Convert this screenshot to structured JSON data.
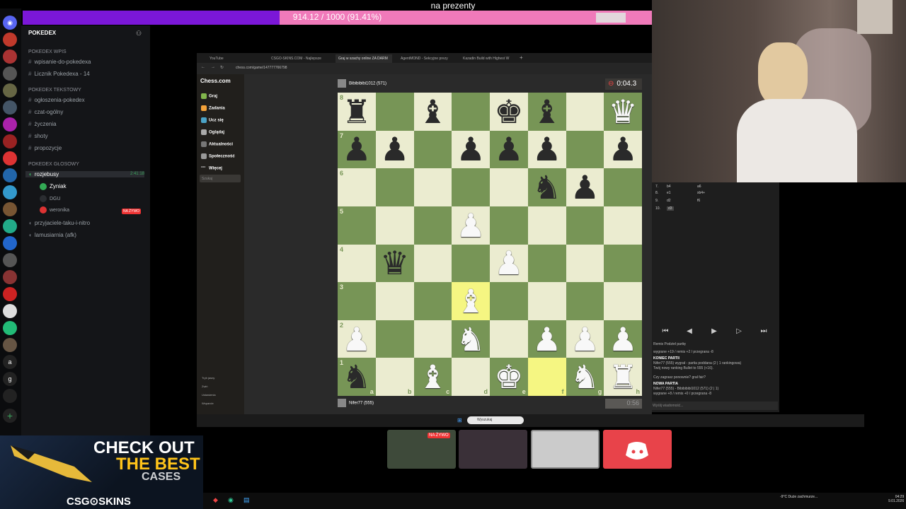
{
  "stream": {
    "goal_title": "na prezenty",
    "goal_text": "914.12 / 1000 (91.41%)",
    "goal_progress": 0.9141,
    "accent": "#7b17d8",
    "fill": "#f07aba"
  },
  "discord": {
    "server_name": "POKEDEX",
    "categories": {
      "wpis": "POKEDEX Wpis",
      "tekstowy": "POKEDEX Tekstowy",
      "glosowy": "POKEDEX GŁOSOWY"
    },
    "channels": {
      "wpisanie": "wpisanie-do-pokedexa",
      "licznik": "Licznik Pokedexa - 14",
      "ogloszenia": "ogłoszenia-pokedex",
      "czat": "czat-ogólny",
      "zyczenia": "życzenia",
      "shoty": "shoty",
      "propozycje": "propozycje",
      "voice_active": "rozjebusy",
      "voice_time": "2:41:18",
      "voice_user1": "Zyniak",
      "live_badge": "NA ŻYWO",
      "voice_user2": "DGU",
      "voice_user3": "weronika",
      "voice_other1": "przyjaciele-taku-i-nitro",
      "voice_other2": "lamusiarnia (afk)"
    }
  },
  "browser": {
    "tabs": [
      "YouTube",
      "CSGO-SKINS.COM - Najlepsze",
      "Graj w szachy online ZA DARM",
      "AgentMOND - Sekcyjne prezy",
      "Kazadin Build with Highest W"
    ],
    "url": "chess.com/game/147777766798",
    "chess_logo": "Chess.com",
    "nav": [
      "Graj",
      "Zadania",
      "Ucz się",
      "Oglądaj",
      "Aktualności",
      "Społeczność",
      "Więcej"
    ],
    "search_placeholder": "Szukaj",
    "footer_nav": [
      "Tryb jasny",
      "Zwiń",
      "Ustawienia",
      "Wsparcie"
    ]
  },
  "game": {
    "top_player": "Bibibibibi1012 (571)",
    "bottom_player": "Nifer77 (555)",
    "top_clock": "0:04.3",
    "bottom_clock": "0:56",
    "files": [
      "a",
      "b",
      "c",
      "d",
      "e",
      "f",
      "g",
      "h"
    ],
    "ranks": [
      "8",
      "7",
      "6",
      "5",
      "4",
      "3",
      "2",
      "1"
    ],
    "board": [
      [
        "br",
        "",
        "bb",
        "",
        "bk",
        "bb",
        "",
        "wq"
      ],
      [
        "bp",
        "bp",
        "",
        "bp",
        "bp",
        "bp",
        "",
        "bp"
      ],
      [
        "",
        "",
        "",
        "",
        "",
        "bn",
        "bp",
        ""
      ],
      [
        "",
        "",
        "",
        "wp",
        "",
        "",
        "",
        ""
      ],
      [
        "",
        "bq",
        "",
        "",
        "wp",
        "",
        "",
        ""
      ],
      [
        "",
        "",
        "",
        "wb",
        "",
        "",
        "",
        ""
      ],
      [
        "wp",
        "",
        "",
        "wn",
        "",
        "wp",
        "wp",
        "wp"
      ],
      [
        "bn",
        "",
        "wb",
        "",
        "wk",
        "",
        "wn",
        "wr"
      ]
    ],
    "highlight": [
      "d3",
      "f1"
    ],
    "moves": [
      [
        "7.",
        "b4",
        "a6"
      ],
      [
        "8.",
        "e1",
        "xb4+"
      ],
      [
        "9.",
        "d2",
        "f6"
      ],
      [
        "10.",
        "d3",
        ""
      ]
    ],
    "controls": [
      "⏮",
      "◀",
      "▶",
      "▷",
      "⏭"
    ],
    "chat": [
      {
        "t": "Remis   Podziel partię",
        "b": false
      },
      {
        "t": "wygrane +19 / remis +2 / przegrana -8",
        "b": false
      },
      {
        "t": "KONIEC PARTII",
        "b": true
      },
      {
        "t": "Nifer77 (555) wygrał - partia poddana (2 | 1 rankingowa)",
        "b": false
      },
      {
        "t": "Twój nowy ranking Bullet to 555 (+16).",
        "b": false
      },
      {
        "t": "Czy zagrasz ponownie? grał fair?",
        "b": false
      },
      {
        "t": "NOWA PARTIA",
        "b": true
      },
      {
        "t": "Nifer77 (555) - Bibibibibi1012 (571) (2 | 1)",
        "b": false
      },
      {
        "t": "wygrane +8 / remis +0 / przegrana -8",
        "b": false
      }
    ],
    "chat_placeholder": "Wyślij wiadomość..."
  },
  "taskbar": {
    "search": "Wyszukaj",
    "weather": "-9°C Duże zachmurze...",
    "time": "04:29",
    "date": "9.01.2026"
  },
  "overlay": {
    "live_badge": "NA ŻYWO"
  },
  "ad": {
    "line1": "CHECK OUT",
    "line2": "THE BEST",
    "line3": "CASES",
    "brand": "CSG⊙SKINS"
  }
}
